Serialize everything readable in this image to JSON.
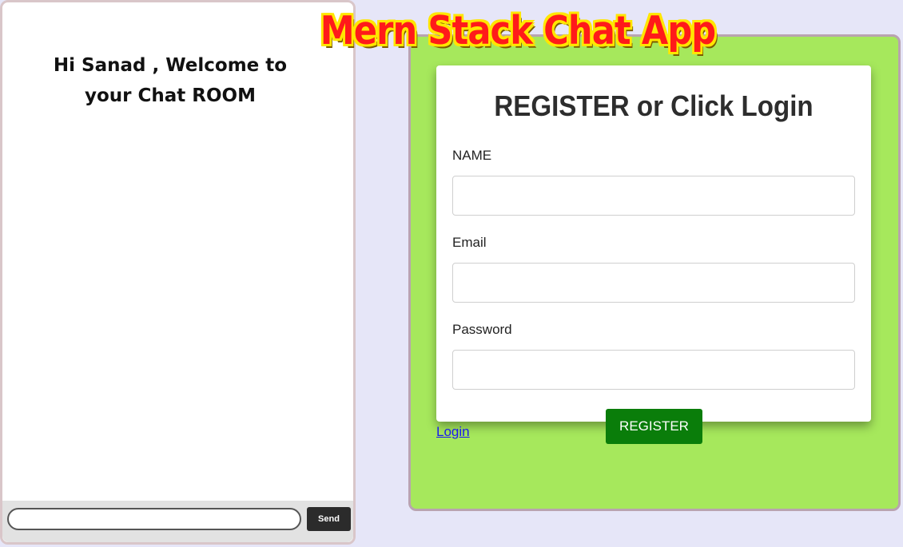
{
  "banner": {
    "title": "Mern Stack Chat App"
  },
  "chat": {
    "welcome": "Hi Sanad , Welcome to your Chat ROOM",
    "input_value": "",
    "send_label": "Send"
  },
  "register": {
    "title": "REGISTER or Click Login",
    "fields": [
      {
        "label": "NAME",
        "value": ""
      },
      {
        "label": "Email",
        "value": ""
      },
      {
        "label": "Password",
        "value": ""
      }
    ],
    "register_label": "REGISTER",
    "login_label": "Login"
  },
  "colors": {
    "page_bg": "#e6e6f8",
    "panel_green": "#a6e85c",
    "register_button": "#0a7d0a",
    "banner_text": "#ff1a1a",
    "banner_outline": "#ffe600"
  }
}
